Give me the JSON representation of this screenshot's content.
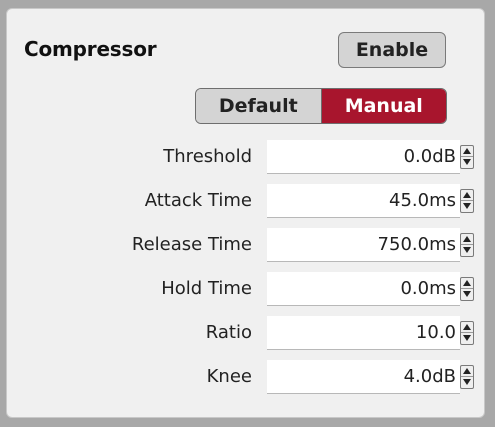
{
  "header": {
    "title": "Compressor",
    "enable_label": "Enable"
  },
  "mode": {
    "options": [
      "Default",
      "Manual"
    ],
    "selected": "Manual"
  },
  "params": [
    {
      "label": "Threshold",
      "value": "0.0dB"
    },
    {
      "label": "Attack Time",
      "value": "45.0ms"
    },
    {
      "label": "Release Time",
      "value": "750.0ms"
    },
    {
      "label": "Hold Time",
      "value": "0.0ms"
    },
    {
      "label": "Ratio",
      "value": "10.0"
    },
    {
      "label": "Knee",
      "value": "4.0dB"
    }
  ],
  "colors": {
    "manual_active": "#a8152d",
    "button_bg": "#d4d4d4",
    "panel_bg": "#f0f0f0"
  },
  "icons": {
    "spinner_up": "triangle-up-icon",
    "spinner_down": "triangle-down-icon"
  }
}
